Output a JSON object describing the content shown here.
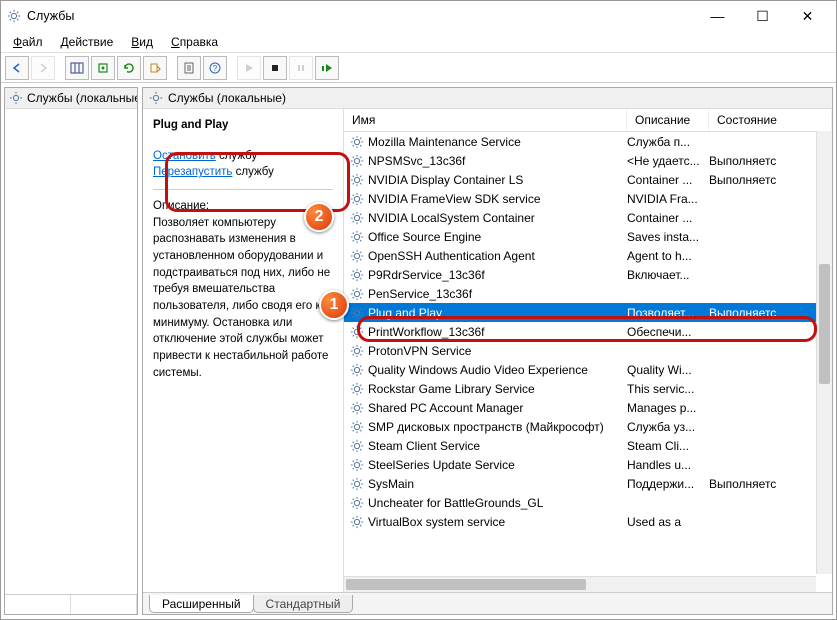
{
  "window": {
    "title": "Службы"
  },
  "menu": {
    "file": "Файл",
    "action": "Действие",
    "view": "Вид",
    "help": "Справка"
  },
  "tree": {
    "root": "Службы (локальные)"
  },
  "main": {
    "header": "Службы (локальные)",
    "columns": {
      "name": "Имя",
      "desc": "Описание",
      "state": "Состояние"
    }
  },
  "details": {
    "title": "Plug and Play",
    "stop_link": "Остановить",
    "stop_suffix": " службу",
    "restart_link": "Перезапустить",
    "restart_suffix": " службу",
    "desc_label": "Описание:",
    "desc_text": "Позволяет компьютеру распознавать изменения в установленном оборудовании и подстраиваться под них, либо не требуя вмешательства пользователя, либо сводя его к минимуму. Остановка или отключение этой службы может привести к нестабильной работе системы."
  },
  "services": [
    {
      "name": "Mozilla Maintenance Service",
      "desc": "Служба п...",
      "state": ""
    },
    {
      "name": "NPSMSvc_13c36f",
      "desc": "<Не удаетс...",
      "state": "Выполняетс"
    },
    {
      "name": "NVIDIA Display Container LS",
      "desc": "Container ...",
      "state": "Выполняетс"
    },
    {
      "name": "NVIDIA FrameView SDK service",
      "desc": "NVIDIA Fra...",
      "state": ""
    },
    {
      "name": "NVIDIA LocalSystem Container",
      "desc": "Container ...",
      "state": ""
    },
    {
      "name": "Office  Source Engine",
      "desc": "Saves insta...",
      "state": ""
    },
    {
      "name": "OpenSSH Authentication Agent",
      "desc": "Agent to h...",
      "state": ""
    },
    {
      "name": "P9RdrService_13c36f",
      "desc": "Включает...",
      "state": ""
    },
    {
      "name": "PenService_13c36f",
      "desc": "",
      "state": ""
    },
    {
      "name": "Plug and Play",
      "desc": "Позволяет...",
      "state": "Выполняетс",
      "selected": true
    },
    {
      "name": "PrintWorkflow_13c36f",
      "desc": "Обеспечи...",
      "state": ""
    },
    {
      "name": "ProtonVPN Service",
      "desc": "",
      "state": ""
    },
    {
      "name": "Quality Windows Audio Video Experience",
      "desc": "Quality Wi...",
      "state": ""
    },
    {
      "name": "Rockstar Game Library Service",
      "desc": "This servic...",
      "state": ""
    },
    {
      "name": "Shared PC Account Manager",
      "desc": "Manages p...",
      "state": ""
    },
    {
      "name": "SMP дисковых пространств (Майкрософт)",
      "desc": "Служба уз...",
      "state": ""
    },
    {
      "name": "Steam Client Service",
      "desc": "Steam Cli...",
      "state": ""
    },
    {
      "name": "SteelSeries Update Service",
      "desc": "Handles u...",
      "state": ""
    },
    {
      "name": "SysMain",
      "desc": "Поддержи...",
      "state": "Выполняетс"
    },
    {
      "name": "Uncheater for BattleGrounds_GL",
      "desc": "",
      "state": ""
    },
    {
      "name": "VirtualBox system service",
      "desc": "Used as a",
      "state": ""
    }
  ],
  "tabs": {
    "ext": "Расширенный",
    "std": "Стандартный"
  },
  "annotations": {
    "b1": "1",
    "b2": "2"
  }
}
